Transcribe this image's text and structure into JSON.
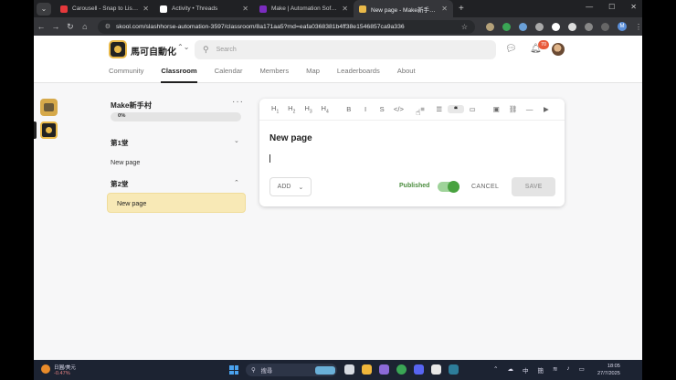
{
  "browser": {
    "tabs": [
      {
        "title": "Carousell - Snap to List, Chat",
        "favicon_color": "#e5383b",
        "active": false
      },
      {
        "title": "Activity • Threads",
        "favicon_color": "#ffffff",
        "active": false
      },
      {
        "title": "Make | Automation Software",
        "favicon_color": "#7b2cbf",
        "active": false
      },
      {
        "title": "New page - Make新手村 · 馬",
        "favicon_color": "#e9b949",
        "active": true
      }
    ],
    "url": "skool.com/slashhorse-automation-3597/classroom/8a171aa5?md=eafa0368381b4ff38e1546857ca9a336"
  },
  "header": {
    "group_name": "馬可自動化",
    "search_placeholder": "Search",
    "notification_count": "70",
    "nav": [
      {
        "label": "Community",
        "active": false
      },
      {
        "label": "Classroom",
        "active": true
      },
      {
        "label": "Calendar",
        "active": false
      },
      {
        "label": "Members",
        "active": false
      },
      {
        "label": "Map",
        "active": false
      },
      {
        "label": "Leaderboards",
        "active": false
      },
      {
        "label": "About",
        "active": false
      }
    ]
  },
  "course": {
    "title": "Make新手村",
    "progress_label": "0%",
    "progress": 0,
    "sections": [
      {
        "title": "第1堂",
        "expanded": false,
        "lessons": [
          "New page"
        ]
      },
      {
        "title": "第2堂",
        "expanded": true,
        "lessons": [
          "New page"
        ]
      }
    ]
  },
  "editor": {
    "toolbar": [
      {
        "name": "heading-1-button",
        "label": "H",
        "sub": "1"
      },
      {
        "name": "heading-2-button",
        "label": "H",
        "sub": "2"
      },
      {
        "name": "heading-3-button",
        "label": "H",
        "sub": "3"
      },
      {
        "name": "heading-4-button",
        "label": "H",
        "sub": "4"
      },
      {
        "name": "bold-button",
        "label": "B",
        "sub": ""
      },
      {
        "name": "italic-button",
        "label": "I",
        "sub": ""
      },
      {
        "name": "strikethrough-button",
        "label": "S",
        "sub": ""
      },
      {
        "name": "code-button",
        "label": "</>",
        "sub": ""
      },
      {
        "name": "align-button",
        "label": "≡",
        "sub": ""
      },
      {
        "name": "bullet-list-button",
        "label": "☰",
        "sub": ""
      },
      {
        "name": "quote-button",
        "label": "❝",
        "sub": ""
      },
      {
        "name": "embed-button",
        "label": "▭",
        "sub": ""
      },
      {
        "name": "image-button",
        "label": "▣",
        "sub": ""
      },
      {
        "name": "link-button",
        "label": "⛓",
        "sub": ""
      },
      {
        "name": "divider-button",
        "label": "—",
        "sub": ""
      },
      {
        "name": "video-button",
        "label": "▶",
        "sub": ""
      }
    ],
    "page_title": "New page",
    "add_label": "ADD",
    "published_label": "Published",
    "published": true,
    "cancel_label": "CANCEL",
    "save_label": "SAVE"
  },
  "taskbar": {
    "weather_line1": "日圓/美元",
    "weather_line2": "-0.47%",
    "search_label": "搜尋",
    "ime_1": "中",
    "ime_2": "簡",
    "time": "18:05",
    "date": "27/7/2025"
  }
}
